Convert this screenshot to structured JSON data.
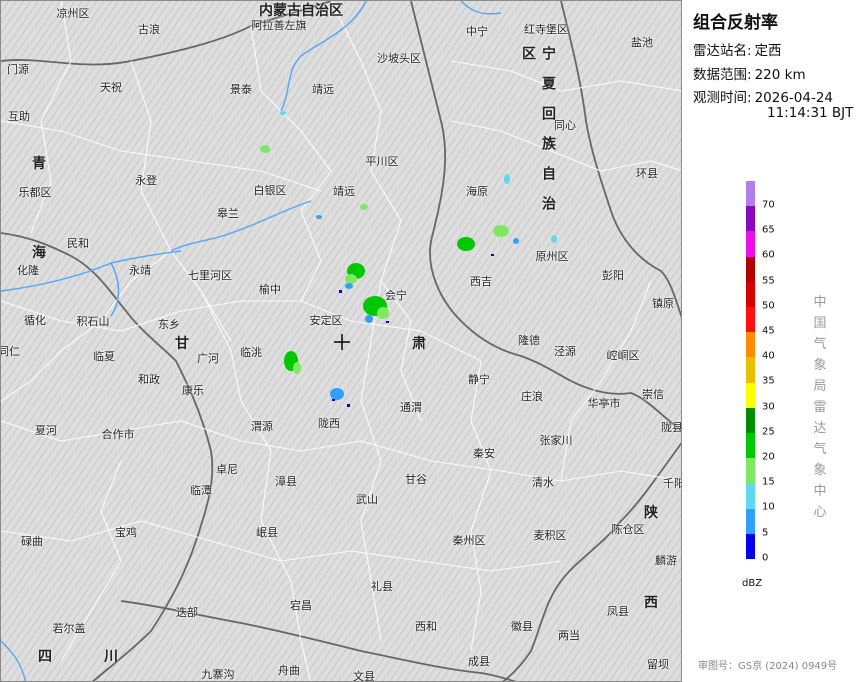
{
  "title": "组合反射率",
  "station_label": "雷达站名:",
  "station_name": "定西",
  "range_label": "数据范围:",
  "range_value": "220 km",
  "time_label": "观测时间:",
  "time_date": "2026-04-24",
  "time_clock": "11:14:31 BJT",
  "legend": {
    "unit": "dBZ",
    "items": [
      {
        "value": "70",
        "color": "#b080e8"
      },
      {
        "value": "65",
        "color": "#8a08c0"
      },
      {
        "value": "60",
        "color": "#e810e8"
      },
      {
        "value": "55",
        "color": "#b00000"
      },
      {
        "value": "50",
        "color": "#d60000"
      },
      {
        "value": "45",
        "color": "#ff1010"
      },
      {
        "value": "40",
        "color": "#ff8c00"
      },
      {
        "value": "35",
        "color": "#e8c000"
      },
      {
        "value": "30",
        "color": "#ffff00"
      },
      {
        "value": "25",
        "color": "#008c00"
      },
      {
        "value": "20",
        "color": "#00c800"
      },
      {
        "value": "15",
        "color": "#80e860"
      },
      {
        "value": "10",
        "color": "#60d8f0"
      },
      {
        "value": "5",
        "color": "#30a0ff"
      },
      {
        "value": "0",
        "color": "#0000f0"
      }
    ]
  },
  "organization": "中国气象局雷达气象中心",
  "map_number": "审图号：GS京 (2024) 0949号",
  "map": {
    "regions": [
      "内蒙古自治区",
      "青海",
      "宁夏回族自治区",
      "甘肃",
      "陕西",
      "四川"
    ],
    "places": [
      "凉州区",
      "古浪",
      "阿拉善左旗",
      "中宁",
      "红寺堡区",
      "盐池",
      "门源",
      "天祝",
      "景泰",
      "靖远",
      "沙坡头区",
      "海原",
      "同心",
      "互助",
      "平川区",
      "永登",
      "白银区",
      "靖远",
      "环县",
      "乐都区",
      "皋兰",
      "西吉",
      "原州区",
      "民和",
      "七里河区",
      "彭阳",
      "化隆",
      "永靖",
      "榆中",
      "会宁",
      "隆德",
      "镇原",
      "循化",
      "积石山",
      "东乡",
      "安定区",
      "泾源",
      "崆峒区",
      "同仁",
      "临夏",
      "临洮",
      "广河",
      "和政",
      "康乐",
      "静宁",
      "崇信",
      "夏河",
      "合作市",
      "卓尼",
      "渭源",
      "陇西",
      "通渭",
      "庄浪",
      "华亭市",
      "临潭",
      "张家川",
      "清水",
      "秦安",
      "漳县",
      "武山",
      "甘谷",
      "麦积区",
      "秦州区",
      "陈仓区",
      "麟游",
      "宕昌",
      "礼县",
      "西和",
      "徽县",
      "凤县",
      "舟曲",
      "迭部",
      "碌曲",
      "若尔盖",
      "九寨沟",
      "文县",
      "成县",
      "两当",
      "留坝",
      "岷县",
      "陇县",
      "千阳",
      "宝鸡"
    ]
  }
}
